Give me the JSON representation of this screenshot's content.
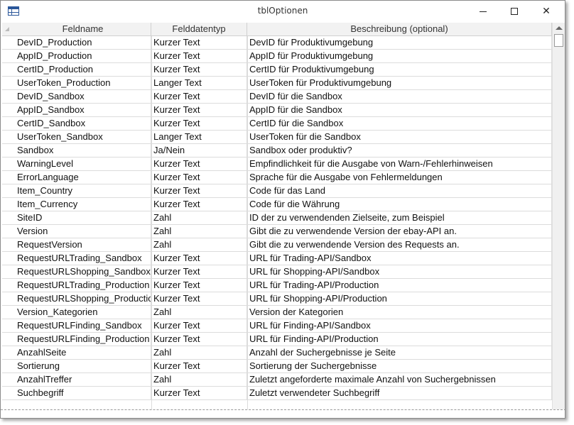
{
  "window": {
    "title": "tblOptionen"
  },
  "table": {
    "headers": [
      "Feldname",
      "Felddatentyp",
      "Beschreibung (optional)"
    ],
    "rows": [
      [
        "DevID_Production",
        "Kurzer Text",
        "DevID für Produktivumgebung"
      ],
      [
        "AppID_Production",
        "Kurzer Text",
        "AppID für Produktivumgebung"
      ],
      [
        "CertID_Production",
        "Kurzer Text",
        "CertID für Produktivumgebung"
      ],
      [
        "UserToken_Production",
        "Langer Text",
        "UserToken für Produktivumgebung"
      ],
      [
        "DevID_Sandbox",
        "Kurzer Text",
        "DevID für die Sandbox"
      ],
      [
        "AppID_Sandbox",
        "Kurzer Text",
        "AppID für die Sandbox"
      ],
      [
        "CertID_Sandbox",
        "Kurzer Text",
        "CertID für die Sandbox"
      ],
      [
        "UserToken_Sandbox",
        "Langer Text",
        "UserToken für die Sandbox"
      ],
      [
        "Sandbox",
        "Ja/Nein",
        "Sandbox oder produktiv?"
      ],
      [
        "WarningLevel",
        "Kurzer Text",
        "Empfindlichkeit für die Ausgabe von Warn-/Fehlerhinweisen"
      ],
      [
        "ErrorLanguage",
        "Kurzer Text",
        "Sprache für die Ausgabe von Fehlermeldungen"
      ],
      [
        "Item_Country",
        "Kurzer Text",
        "Code für das Land"
      ],
      [
        "Item_Currency",
        "Kurzer Text",
        "Code für die Währung"
      ],
      [
        "SiteID",
        "Zahl",
        "ID der zu verwendenden Zielseite, zum Beispiel"
      ],
      [
        "Version",
        "Zahl",
        "Gibt die zu verwendende Version der ebay-API an."
      ],
      [
        "RequestVersion",
        "Zahl",
        "Gibt die zu verwendende Version des Requests an."
      ],
      [
        "RequestURLTrading_Sandbox",
        "Kurzer Text",
        "URL für Trading-API/Sandbox"
      ],
      [
        "RequestURLShopping_Sandbox",
        "Kurzer Text",
        "URL für Shopping-API/Sandbox"
      ],
      [
        "RequestURLTrading_Production",
        "Kurzer Text",
        "URL für Trading-API/Production"
      ],
      [
        "RequestURLShopping_Production",
        "Kurzer Text",
        "URL für Shopping-API/Production"
      ],
      [
        "Version_Kategorien",
        "Zahl",
        "Version der Kategorien"
      ],
      [
        "RequestURLFinding_Sandbox",
        "Kurzer Text",
        "URL für Finding-API/Sandbox"
      ],
      [
        "RequestURLFinding_Production",
        "Kurzer Text",
        "URL für Finding-API/Production"
      ],
      [
        "AnzahlSeite",
        "Zahl",
        "Anzahl der Suchergebnisse je Seite"
      ],
      [
        "Sortierung",
        "Kurzer Text",
        "Sortierung der Suchergebnisse"
      ],
      [
        "AnzahlTreffer",
        "Zahl",
        "Zuletzt angeforderte maximale Anzahl von Suchergebnissen"
      ],
      [
        "Suchbegriff",
        "Kurzer Text",
        "Zuletzt verwendeter Suchbegriff"
      ]
    ]
  },
  "icons": {
    "app": "table-icon",
    "minimize": "minimize-icon",
    "maximize": "maximize-icon",
    "close": "close-icon"
  }
}
